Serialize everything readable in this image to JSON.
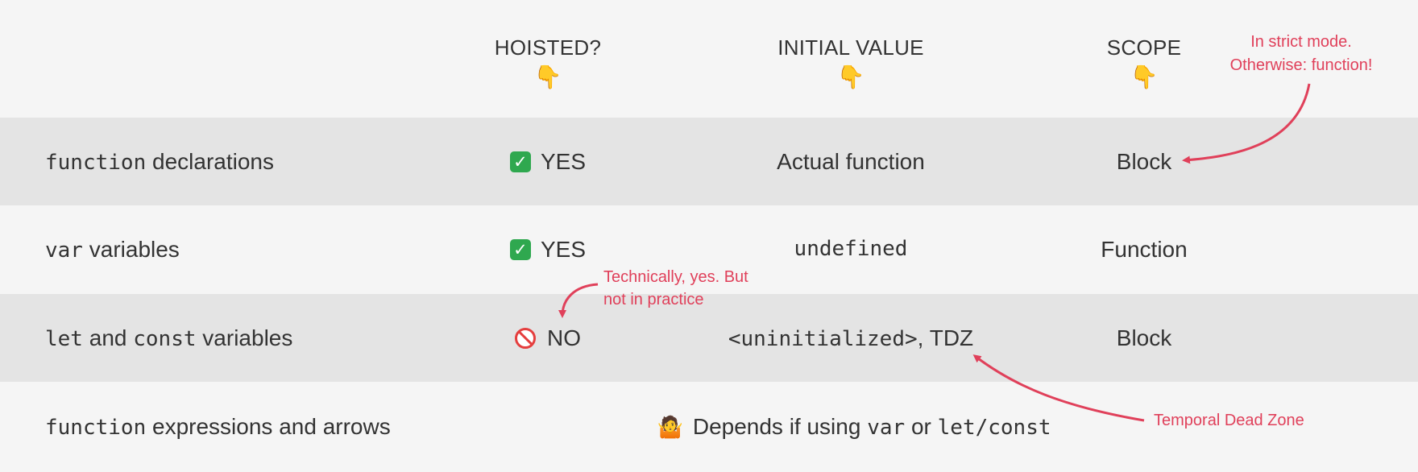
{
  "headers": {
    "hoisted": "HOISTED?",
    "initial_value": "INITIAL VALUE",
    "scope": "SCOPE",
    "pointer_glyph": "👇"
  },
  "rows": [
    {
      "name_code": "function",
      "name_text": " declarations",
      "hoisted": "YES",
      "hoisted_icon": "check-icon",
      "initial_value": "Actual function",
      "scope": "Block"
    },
    {
      "name_code": "var",
      "name_text": " variables",
      "hoisted": "YES",
      "hoisted_icon": "check-icon",
      "initial_value": "undefined",
      "scope": "Function"
    },
    {
      "name_code1": "let",
      "name_text1": " and ",
      "name_code2": "const",
      "name_text2": " variables",
      "hoisted": "NO",
      "hoisted_icon": "prohibited-icon",
      "initial_value_code": "<uninitialized>",
      "initial_value_text": ", TDZ",
      "scope": "Block"
    },
    {
      "name_code": "function",
      "name_text": " expressions and arrows",
      "merged_icon": "shrug-icon",
      "merged_pre": "Depends if using ",
      "merged_code1": "var",
      "merged_mid": " or ",
      "merged_code2": "let/const"
    }
  ],
  "notes": {
    "strict_mode_line1": "In strict mode.",
    "strict_mode_line2": "Otherwise: function!",
    "technically_line1": "Technically, yes. But",
    "technically_line2": "not in practice",
    "tdz": "Temporal Dead Zone"
  },
  "colors": {
    "accent": "#e0405a",
    "shaded_row": "#e4e4e4",
    "background": "#f5f5f5",
    "check": "#2fa84f"
  }
}
